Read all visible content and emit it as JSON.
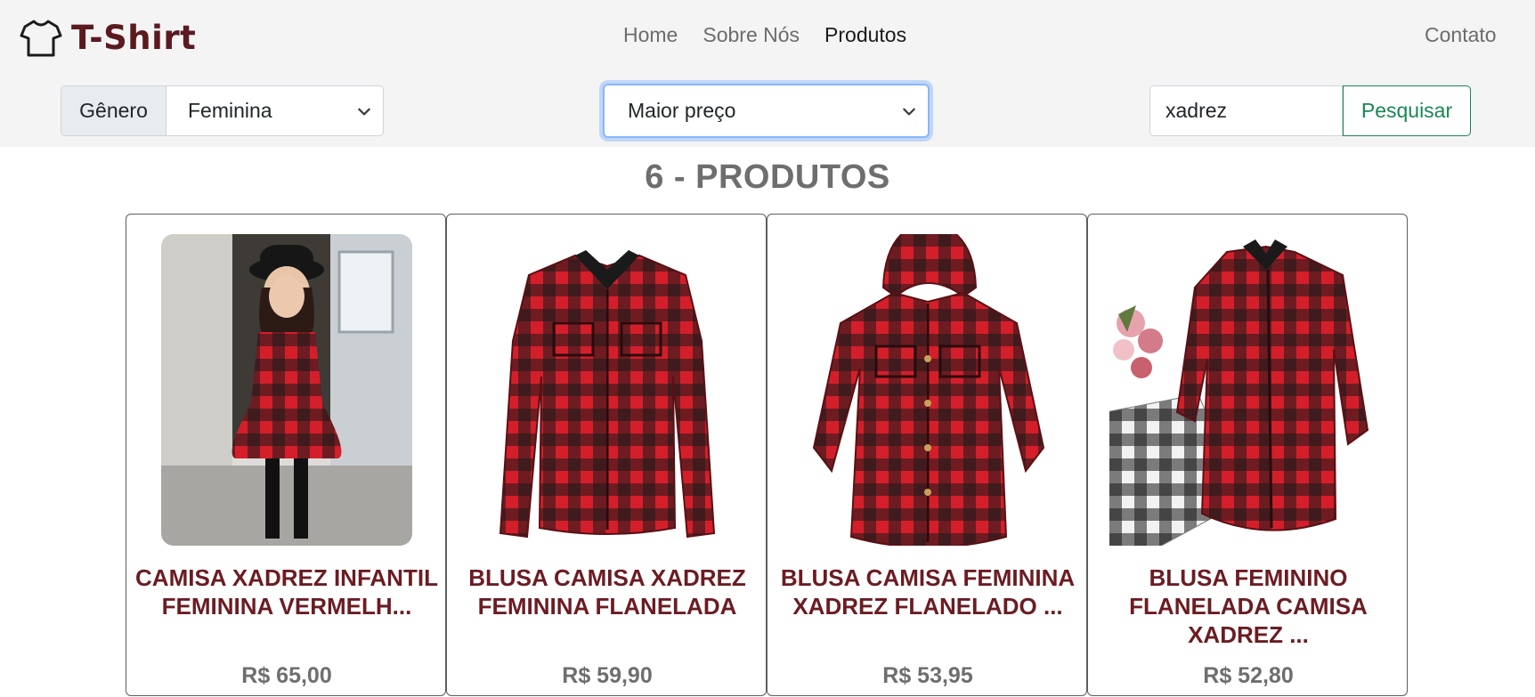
{
  "brand": {
    "name": "T-Shirt",
    "icon": "tshirt-icon"
  },
  "nav": {
    "items": [
      {
        "label": "Home",
        "active": false
      },
      {
        "label": "Sobre Nós",
        "active": false
      },
      {
        "label": "Produtos",
        "active": true
      }
    ],
    "contact": "Contato"
  },
  "filters": {
    "genre_label": "Gênero",
    "genre_value": "Feminina",
    "sort_value": "Maior preço",
    "search_value": "xadrez",
    "search_button": "Pesquisar"
  },
  "results_heading": "6 - PRODUTOS",
  "products": [
    {
      "title": "CAMISA XADREZ INFANTIL FEMININA VERMELH...",
      "price": "R$ 65,00"
    },
    {
      "title": "BLUSA CAMISA XADREZ FEMININA FLANELADA",
      "price": "R$ 59,90"
    },
    {
      "title": "BLUSA CAMISA FEMININA XADREZ FLANELADO ...",
      "price": "R$ 53,95"
    },
    {
      "title": "BLUSA FEMININO FLANELADA CAMISA XADREZ ...",
      "price": "R$ 52,80"
    }
  ],
  "colors": {
    "brand": "#5b1a1f",
    "product_title": "#6b1c22",
    "search_button": "#198754",
    "focus_ring": "#86b7fe"
  }
}
